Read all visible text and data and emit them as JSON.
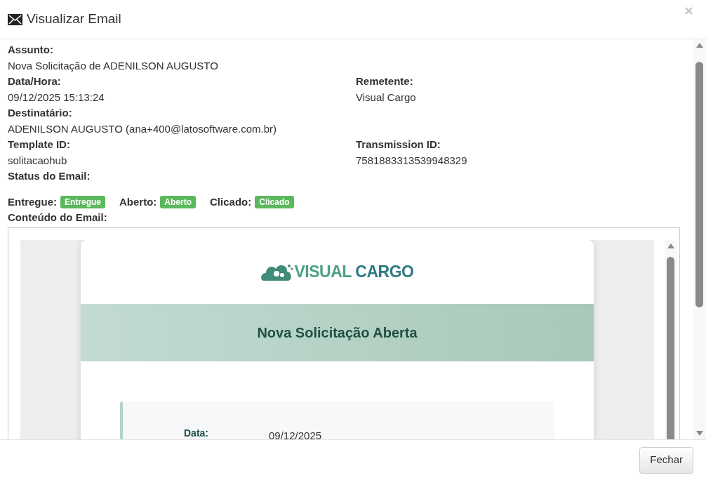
{
  "modal": {
    "title": "Visualizar Email"
  },
  "rows": [
    [
      {
        "label": "Assunto:",
        "value": "Nova Solicitação de ADENILSON AUGUSTO"
      }
    ],
    [
      {
        "label": "Data/Hora:",
        "value": "09/12/2025 15:13:24"
      },
      {
        "label": "Remetente:",
        "value": "Visual Cargo"
      }
    ],
    [
      {
        "label": "Destinatário:",
        "value": "ADENILSON AUGUSTO (ana+400@latosoftware.com.br)"
      }
    ],
    [
      {
        "label": "Template ID:",
        "value": "solitacaohub"
      },
      {
        "label": "Transmission ID:",
        "value": "7581883313539948329"
      }
    ],
    [
      {
        "label": "Status do Email:"
      }
    ]
  ],
  "status": [
    {
      "label": "Entregue:",
      "badge": "Entregue",
      "color": "#5cb85c"
    },
    {
      "label": "Aberto:",
      "badge": "Aberto",
      "color": "#5cb85c"
    },
    {
      "label": "Clicado:",
      "badge": "Clicado",
      "color": "#5cb85c"
    }
  ],
  "content_label": "Conteúdo do Email:",
  "email": {
    "logo": [
      "VISUAL",
      "CARGO"
    ],
    "banner": "Nova Solicitação Aberta",
    "details": [
      {
        "label": "Data:",
        "value": "09/12/2025"
      }
    ]
  },
  "footer": {
    "button": "Fechar"
  }
}
